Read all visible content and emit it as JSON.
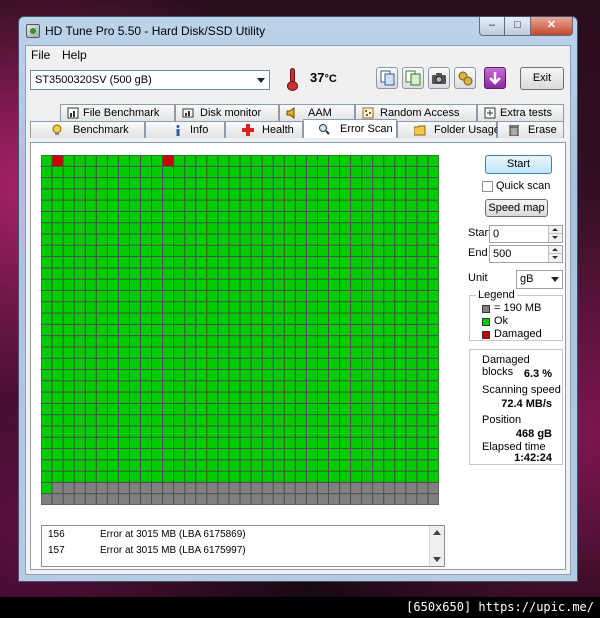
{
  "window": {
    "title": "HD Tune Pro 5.50 - Hard Disk/SSD Utility"
  },
  "menu": [
    {
      "label": "File"
    },
    {
      "label": "Help"
    }
  ],
  "toolbar": {
    "drive": "ST3500320SV (500 gB)",
    "temperature": "37",
    "temperature_unit": "°C",
    "exit_label": "Exit"
  },
  "tabs_top": [
    {
      "label": "File Benchmark",
      "icon": "file-benchmark-icon"
    },
    {
      "label": "Disk monitor",
      "icon": "disk-monitor-icon"
    },
    {
      "label": "AAM",
      "icon": "speaker-icon"
    },
    {
      "label": "Random Access",
      "icon": "random-access-icon"
    },
    {
      "label": "Extra tests",
      "icon": "extra-tests-icon"
    }
  ],
  "tabs_bottom": [
    {
      "label": "Benchmark",
      "icon": "benchmark-icon"
    },
    {
      "label": "Info",
      "icon": "info-icon"
    },
    {
      "label": "Health",
      "icon": "health-cross-icon"
    },
    {
      "label": "Error Scan",
      "icon": "magnifier-icon",
      "active": true
    },
    {
      "label": "Folder Usage",
      "icon": "folder-icon"
    },
    {
      "label": "Erase",
      "icon": "trash-icon"
    }
  ],
  "scan": {
    "grid_cols": 36,
    "grid_rows": 31,
    "scanned_fraction": 0.936,
    "damaged_blocks_at": [
      [
        1,
        0
      ],
      [
        11,
        0
      ]
    ],
    "colors": {
      "ok": "#00cc00",
      "damaged": "#cc0000",
      "unscanned": "#808080",
      "gridline": "#4d4d4d"
    }
  },
  "controls": {
    "start_button": "Start",
    "quick_scan_label": "Quick scan",
    "quick_scan_checked": false,
    "speed_map_button": "Speed map",
    "start_label": "Start",
    "start_value": "0",
    "end_label": "End",
    "end_value": "500",
    "unit_label": "Unit",
    "unit_value": "gB"
  },
  "legend": {
    "title": "Legend",
    "block_size": "= 190 MB",
    "ok": "Ok",
    "damaged": "Damaged"
  },
  "stats": {
    "damaged_label": "Damaged blocks",
    "damaged_value": "6.3 %",
    "speed_label": "Scanning speed",
    "speed_value": "72.4 MB/s",
    "position_label": "Position",
    "position_value": "468 gB",
    "elapsed_label": "Elapsed time",
    "elapsed_value": "1:42:24"
  },
  "log": [
    {
      "num": "156",
      "msg": "Error at 3015 MB (LBA 6175869)"
    },
    {
      "num": "157",
      "msg": "Error at 3015 MB (LBA 6175997)"
    }
  ],
  "footer": {
    "text": "[650x650] https://upic.me/"
  }
}
